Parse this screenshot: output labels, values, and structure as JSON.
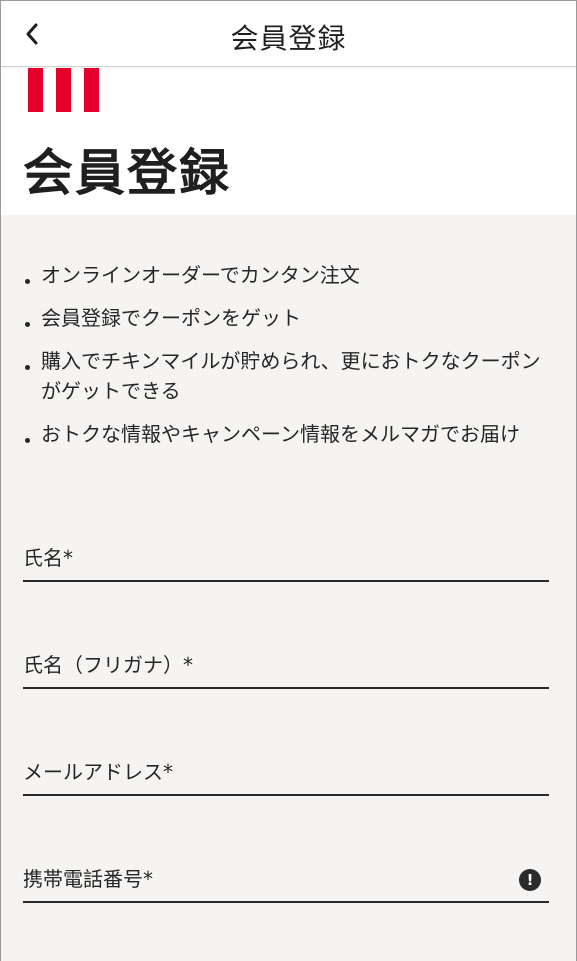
{
  "header": {
    "title": "会員登録",
    "back_icon": "chevron-left-icon"
  },
  "hero": {
    "title": "会員登録",
    "stripe_color": "#e4002b"
  },
  "benefits": [
    "オンラインオーダーでカンタン注文",
    "会員登録でクーポンをゲット",
    "購入でチキンマイルが貯められ、更におトクなクーポンがゲットできる",
    "おトクな情報やキャンペーン情報をメルマガでお届け"
  ],
  "form": {
    "fields": [
      {
        "label": "氏名*"
      },
      {
        "label": "氏名（フリガナ）*"
      },
      {
        "label": "メールアドレス*"
      },
      {
        "label": "携帯電話番号*",
        "icon": "alert-icon",
        "icon_glyph": "!"
      }
    ]
  }
}
